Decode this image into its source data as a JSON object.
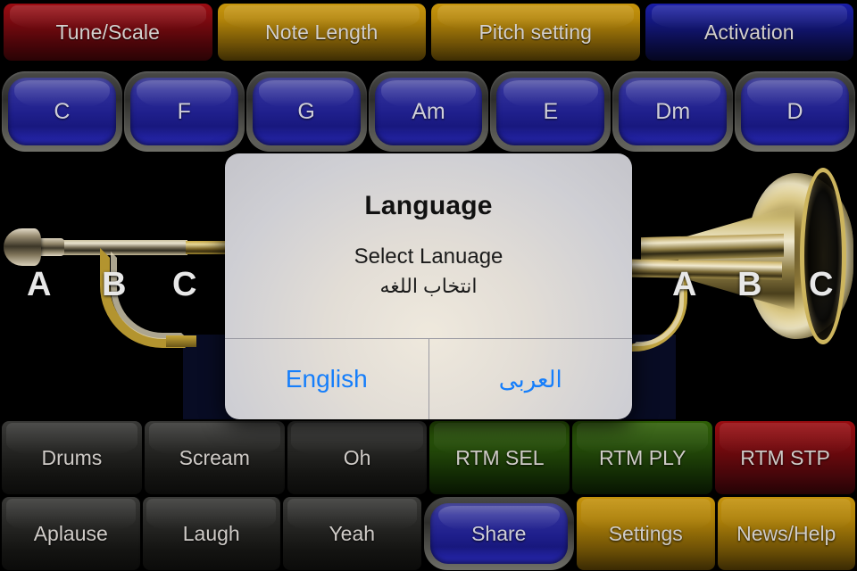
{
  "app": {
    "background_color": "#000000",
    "accent_blue": "#157efb"
  },
  "top_menu": {
    "items": [
      {
        "label": "Tune/Scale",
        "color": "#7d0a10",
        "style": "red"
      },
      {
        "label": "Note Length",
        "color": "#b5860a",
        "style": "gold"
      },
      {
        "label": "Pitch setting",
        "color": "#b5860a",
        "style": "gold"
      },
      {
        "label": "Activation",
        "color": "#14187f",
        "style": "blue"
      }
    ]
  },
  "chords": {
    "items": [
      {
        "label": "C"
      },
      {
        "label": "F"
      },
      {
        "label": "G"
      },
      {
        "label": "Am"
      },
      {
        "label": "E"
      },
      {
        "label": "Dm"
      },
      {
        "label": "D"
      }
    ]
  },
  "stage": {
    "left_trumpet_labels": [
      "A",
      "B",
      "C"
    ],
    "right_trumpet_labels": [
      "A",
      "B",
      "C"
    ]
  },
  "dialog": {
    "title": "Language",
    "subtitle_en": "Select Lanuage",
    "subtitle_ar": "انتخاب اللغه",
    "buttons": [
      {
        "label": "English",
        "color": "#157efb"
      },
      {
        "label": "العربى",
        "color": "#157efb"
      }
    ]
  },
  "sound_pads": {
    "items": [
      {
        "label": "Drums",
        "style": "dark"
      },
      {
        "label": "Scream",
        "style": "dark"
      },
      {
        "label": "Oh",
        "style": "dark"
      },
      {
        "label": "RTM SEL",
        "style": "green"
      },
      {
        "label": "RTM PLY",
        "style": "green"
      },
      {
        "label": "RTM STP",
        "style": "red"
      }
    ]
  },
  "utility_pads": {
    "items": [
      {
        "label": "Aplause",
        "style": "dark"
      },
      {
        "label": "Laugh",
        "style": "dark"
      },
      {
        "label": "Yeah",
        "style": "dark"
      },
      {
        "label": "Share",
        "style": "pill"
      },
      {
        "label": "Settings",
        "style": "gold"
      },
      {
        "label": "News/Help",
        "style": "gold"
      }
    ]
  }
}
